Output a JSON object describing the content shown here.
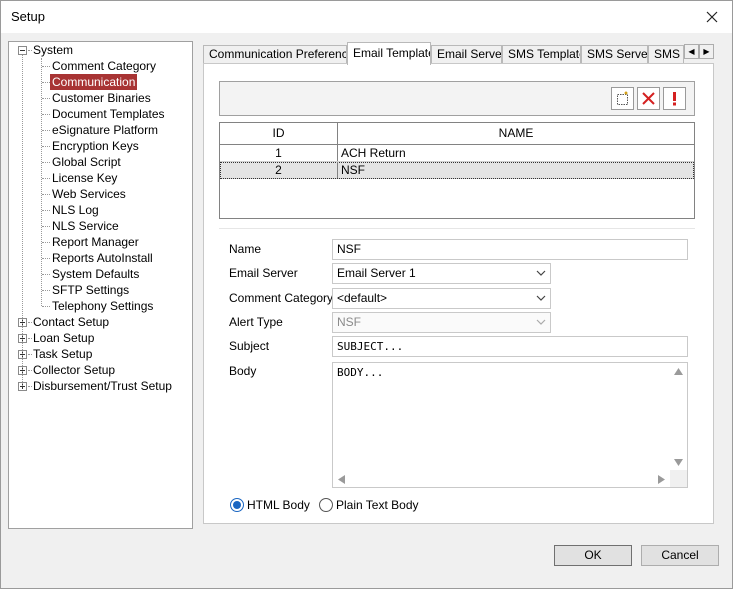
{
  "window": {
    "title": "Setup"
  },
  "tree": {
    "system": "System",
    "system_children": [
      "Comment Category",
      "Communication",
      "Customer Binaries",
      "Document Templates",
      "eSignature Platform",
      "Encryption Keys",
      "Global Script",
      "License Key",
      "Web Services",
      "NLS Log",
      "NLS Service",
      "Report Manager",
      "Reports AutoInstall",
      "System Defaults",
      "SFTP Settings",
      "Telephony Settings"
    ],
    "selected": "Communication",
    "top_level": [
      "Contact Setup",
      "Loan Setup",
      "Task Setup",
      "Collector Setup",
      "Disbursement/Trust Setup"
    ]
  },
  "tabs": [
    {
      "label": "Communication Preferences",
      "active": false
    },
    {
      "label": "Email Template",
      "active": true
    },
    {
      "label": "Email Server",
      "active": false
    },
    {
      "label": "SMS Template",
      "active": false
    },
    {
      "label": "SMS Server",
      "active": false
    },
    {
      "label": "SMS P",
      "active": false
    }
  ],
  "toolbar": {
    "icons": [
      "new-icon",
      "delete-icon",
      "alert-icon"
    ]
  },
  "grid": {
    "columns": [
      "ID",
      "NAME"
    ],
    "rows": [
      {
        "id": "1",
        "name": "ACH Return",
        "selected": false
      },
      {
        "id": "2",
        "name": "NSF",
        "selected": true
      }
    ]
  },
  "form": {
    "name_label": "Name",
    "name_value": "NSF",
    "email_server_label": "Email Server",
    "email_server_value": "Email Server 1",
    "comment_category_label": "Comment Category",
    "comment_category_value": "<default>",
    "alert_type_label": "Alert Type",
    "alert_type_value": "NSF",
    "subject_label": "Subject",
    "subject_value": "SUBJECT...",
    "body_label": "Body",
    "body_value": "BODY...",
    "html_body_label": "HTML Body",
    "plain_text_label": "Plain Text Body",
    "body_format": "HTML Body"
  },
  "buttons": {
    "ok": "OK",
    "cancel": "Cancel"
  },
  "colors": {
    "selection": "#a83434",
    "radio_accent": "#1a66c2",
    "alert_red": "#d42020"
  }
}
